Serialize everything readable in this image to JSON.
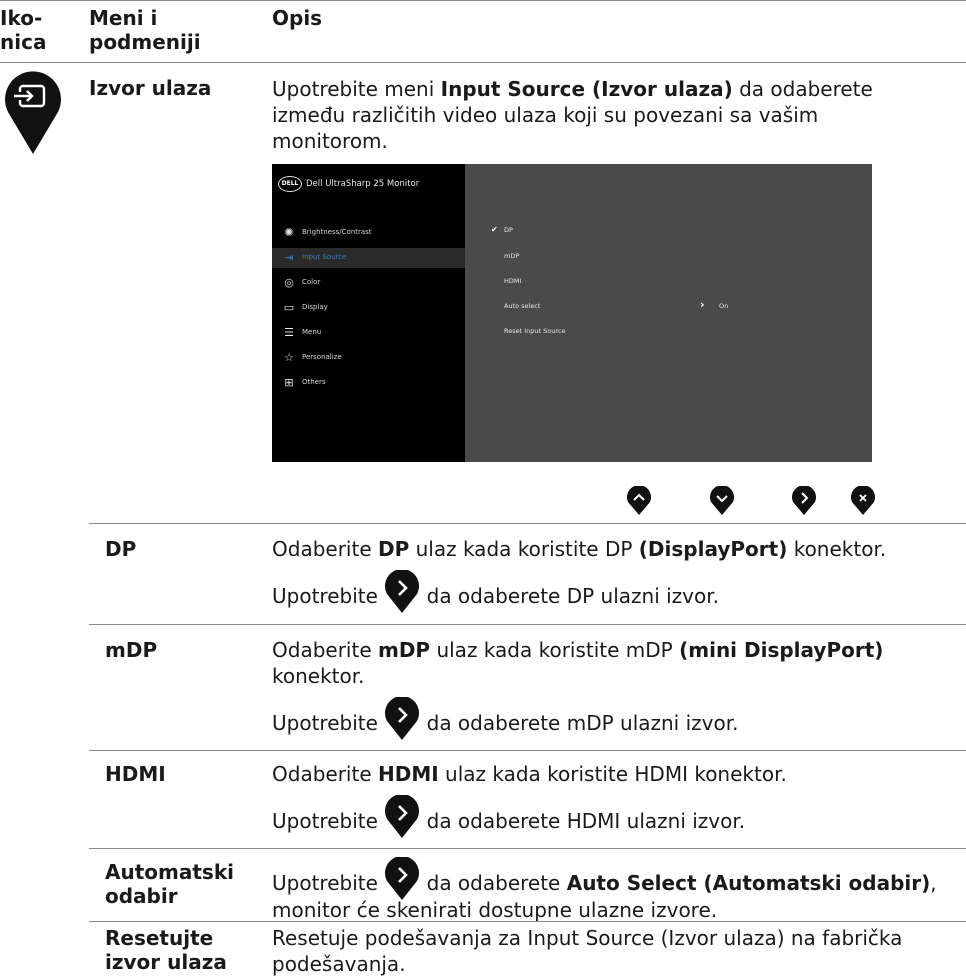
{
  "headers": {
    "col1": "Iko-\nnica",
    "col1_a": "Iko-",
    "col1_b": "nica",
    "col2_a": "Meni i",
    "col2_b": "podmeniji",
    "col3": "Opis"
  },
  "input_source": {
    "label": "Izvor ulaza",
    "desc_pre": "Upotrebite meni ",
    "desc_bold": "Input Source (Izvor ulaza)",
    "desc_post": " da odaberete",
    "desc_line2": "između različitih video ulaza koji su povezani sa vašim",
    "desc_line3": "monitorom."
  },
  "osd": {
    "brand": "DELL",
    "title": "Dell UltraSharp 25 Monitor",
    "menu": [
      "Brightness/Contrast",
      "Input Source",
      "Color",
      "Display",
      "Menu",
      "Personalize",
      "Others"
    ],
    "options": [
      "DP",
      "mDP",
      "HDMI",
      "Auto select",
      "Reset Input Source"
    ],
    "checkmark": "✔",
    "auto_select_value": "On",
    "selected_option": "DP",
    "selected_menu": "Input Source"
  },
  "nav_buttons": [
    "up-icon",
    "down-icon",
    "right-icon",
    "close-icon"
  ],
  "rows": [
    {
      "label": "DP",
      "line1_pre": "Odaberite ",
      "line1_b1": "DP",
      "line1_mid": " ulaz kada koristite DP ",
      "line1_b2": "(DisplayPort)",
      "line1_post": " konektor.",
      "use_pre": "Upotrebite",
      "use_post": "da odaberete DP ulazni izvor."
    },
    {
      "label": "mDP",
      "line1_pre": "Odaberite ",
      "line1_b1": "mDP",
      "line1_mid": " ulaz kada koristite mDP ",
      "line1_b2": "(mini DisplayPort)",
      "line1_post": "",
      "line2": "konektor.",
      "use_pre": "Upotrebite",
      "use_post": "da odaberete mDP ulazni izvor."
    },
    {
      "label": "HDMI",
      "line1_pre": "Odaberite ",
      "line1_b1": "HDMI",
      "line1_mid": " ulaz kada koristite HDMI konektor.",
      "line1_b2": "",
      "line1_post": "",
      "use_pre": "Upotrebite",
      "use_post": "da odaberete HDMI ulazni izvor."
    }
  ],
  "auto": {
    "label_a": "Automatski",
    "label_b": "odabir",
    "pre": "Upotrebite",
    "mid": "da odaberete ",
    "bold": "Auto Select (Automatski odabir)",
    "post": ",",
    "line2": "monitor će skenirati dostupne ulazne izvore."
  },
  "reset": {
    "label_a": "Resetujte",
    "label_b": "izvor ulaza",
    "line1": "Resetuje podešavanja za Input Source (Izvor ulaza) na fabrička",
    "line2": "podešavanja."
  },
  "colors": {
    "pin": "#111111",
    "accent": "#2f7fd1",
    "rule": "#8c8c8c"
  }
}
